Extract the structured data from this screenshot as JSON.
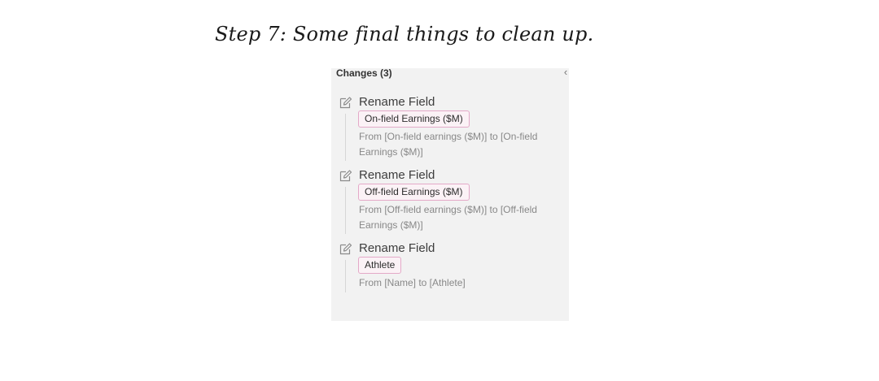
{
  "step_title": "Step 7: Some final things to clean up.",
  "panel": {
    "header": "Changes (3)",
    "collapse_icon": "chevron-left-icon",
    "changes": [
      {
        "icon": "edit-icon",
        "action": "Rename Field",
        "field": "On-field Earnings ($M)",
        "detail": "From [On-field earnings ($M)] to [On-field Earnings ($M)]"
      },
      {
        "icon": "edit-icon",
        "action": "Rename Field",
        "field": "Off-field Earnings ($M)",
        "detail": "From [Off-field earnings ($M)] to [Off-field Earnings ($M)]"
      },
      {
        "icon": "edit-icon",
        "action": "Rename Field",
        "field": "Athlete",
        "detail": "From [Name] to [Athlete]"
      }
    ]
  },
  "colors": {
    "panel_background": "#f2f2f2",
    "pill_border": "#e4a9c8",
    "pill_background": "#fbf2f6"
  }
}
